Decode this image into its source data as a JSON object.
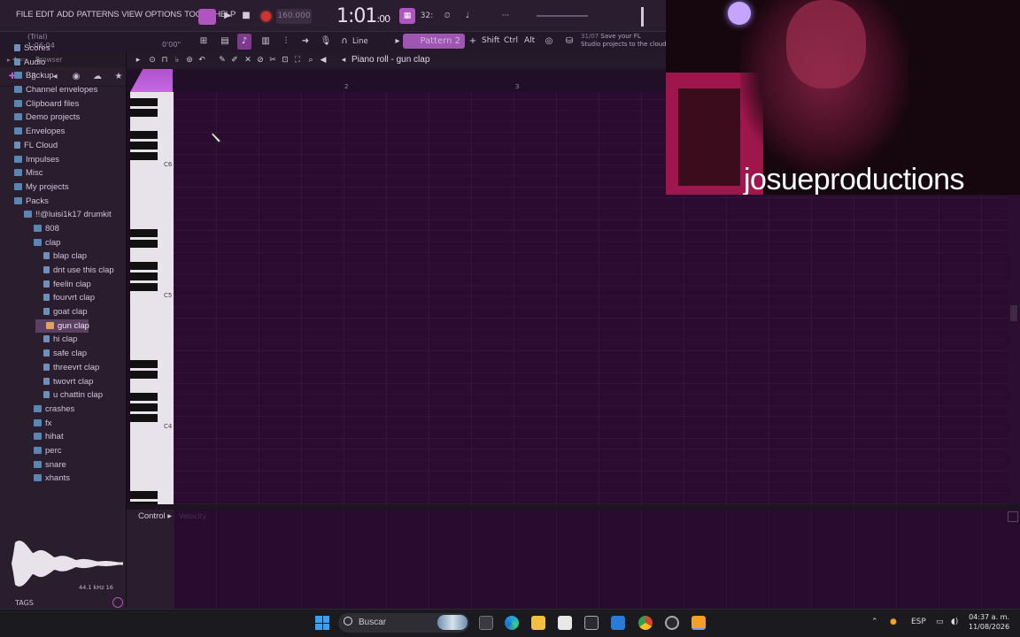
{
  "menu": [
    "FILE",
    "EDIT",
    "ADD",
    "PATTERNS",
    "VIEW",
    "OPTIONS",
    "TOOLS",
    "HELP"
  ],
  "transport": {
    "tempo": "160.000",
    "time_main": "1:01",
    "time_sub": ":00",
    "time_mode": "32:"
  },
  "hint": {
    "line1": "(Trial)",
    "line2": "1:06:04",
    "time": "0'00\""
  },
  "snap": "Line",
  "pattern": "Pattern 2",
  "keys": [
    "Shift",
    "Ctrl",
    "Alt"
  ],
  "news": {
    "date": "31/07",
    "text1": "Save your FL",
    "text2": "Studio projects to the cloud"
  },
  "browser": {
    "header": "Browser",
    "items": [
      {
        "label": "Scores",
        "indent": 0,
        "kind": "file"
      },
      {
        "label": "Audio",
        "indent": 0,
        "kind": "file"
      },
      {
        "label": "Backup",
        "indent": 0,
        "kind": "folder"
      },
      {
        "label": "Channel envelopes",
        "indent": 0,
        "kind": "folder"
      },
      {
        "label": "Clipboard files",
        "indent": 0,
        "kind": "folder"
      },
      {
        "label": "Demo projects",
        "indent": 0,
        "kind": "folder"
      },
      {
        "label": "Envelopes",
        "indent": 0,
        "kind": "folder"
      },
      {
        "label": "FL Cloud",
        "indent": 0,
        "kind": "file"
      },
      {
        "label": "Impulses",
        "indent": 0,
        "kind": "folder"
      },
      {
        "label": "Misc",
        "indent": 0,
        "kind": "folder"
      },
      {
        "label": "My projects",
        "indent": 0,
        "kind": "folder"
      },
      {
        "label": "Packs",
        "indent": 0,
        "kind": "folder"
      },
      {
        "label": "!!@luisi1k17 drumkit",
        "indent": 1,
        "kind": "folder"
      },
      {
        "label": "808",
        "indent": 2,
        "kind": "folder"
      },
      {
        "label": "clap",
        "indent": 2,
        "kind": "folder"
      },
      {
        "label": "blap clap",
        "indent": 3,
        "kind": "file"
      },
      {
        "label": "dnt use this clap",
        "indent": 3,
        "kind": "file"
      },
      {
        "label": "feelin clap",
        "indent": 3,
        "kind": "file"
      },
      {
        "label": "fourvrt clap",
        "indent": 3,
        "kind": "file"
      },
      {
        "label": "goat clap",
        "indent": 3,
        "kind": "file"
      },
      {
        "label": "gun clap",
        "indent": 4,
        "kind": "sel"
      },
      {
        "label": "hi clap",
        "indent": 3,
        "kind": "file"
      },
      {
        "label": "safe clap",
        "indent": 3,
        "kind": "file"
      },
      {
        "label": "threevrt clap",
        "indent": 3,
        "kind": "file"
      },
      {
        "label": "twovrt clap",
        "indent": 3,
        "kind": "file"
      },
      {
        "label": "u chattin clap",
        "indent": 3,
        "kind": "file"
      },
      {
        "label": "crashes",
        "indent": 2,
        "kind": "folder"
      },
      {
        "label": "fx",
        "indent": 2,
        "kind": "folder"
      },
      {
        "label": "hihat",
        "indent": 2,
        "kind": "folder"
      },
      {
        "label": "perc",
        "indent": 2,
        "kind": "folder"
      },
      {
        "label": "snare",
        "indent": 2,
        "kind": "folder"
      },
      {
        "label": "xhants",
        "indent": 2,
        "kind": "folder"
      }
    ],
    "wave_info": "44.1 kHz 16",
    "tags": "TAGS"
  },
  "pianoroll": {
    "title": "Piano roll - gun clap",
    "ruler": [
      "2",
      "3"
    ],
    "octaves": [
      "C6",
      "C5",
      "C4"
    ]
  },
  "event": {
    "control": "Control",
    "param": "Velocity"
  },
  "webcam": {
    "name": "josueproductions"
  },
  "taskbar": {
    "search": "Buscar",
    "lang": "ESP",
    "time": "04:37 a. m.",
    "date": "11/08/2026"
  }
}
